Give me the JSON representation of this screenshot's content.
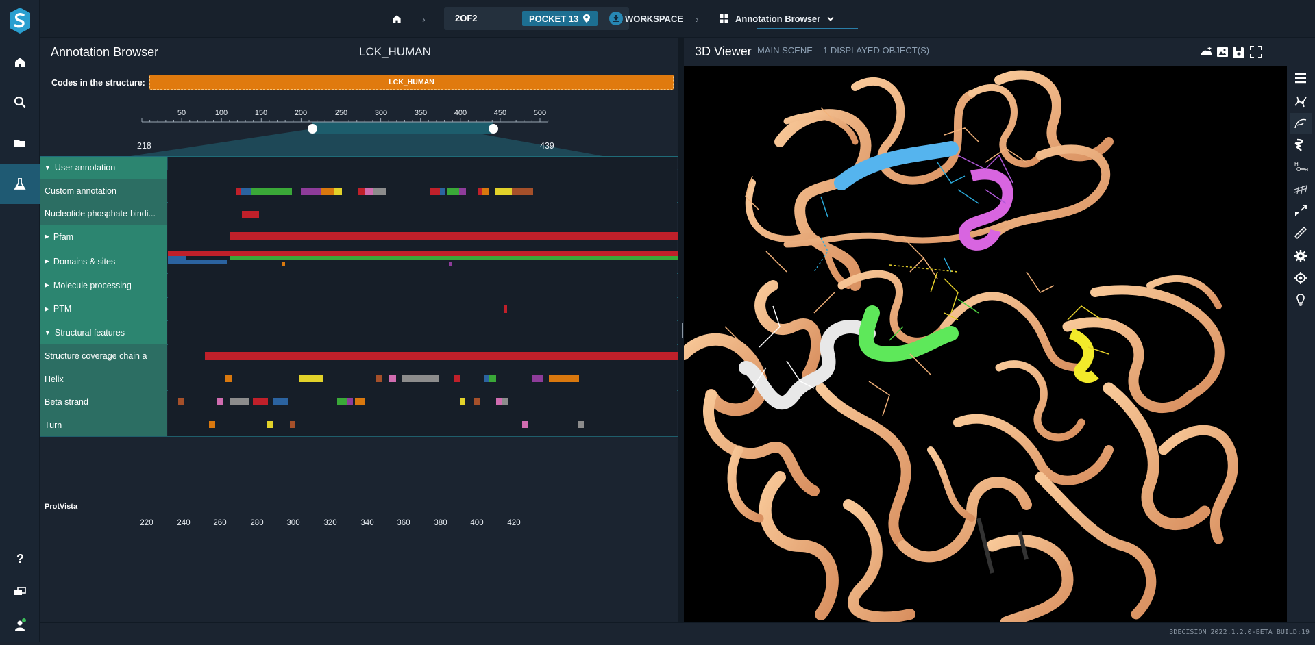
{
  "colors": {
    "accent": "#1d6f92",
    "track_label": "#2c6e63",
    "track_group": "#2c8570",
    "codes_bar": "#e07a0e",
    "protein_ribbon": "#f8c090"
  },
  "nav": {
    "logo_icon": "3decision-logo",
    "items": [
      {
        "name": "home-icon"
      },
      {
        "name": "search-icon"
      },
      {
        "name": "folder-icon"
      },
      {
        "name": "flask-icon"
      },
      {
        "name": "help-icon"
      },
      {
        "name": "chat-icon"
      },
      {
        "name": "user-icon"
      }
    ]
  },
  "topbar": {
    "structure": "2OF2",
    "pocket": "POCKET 13",
    "workspace": "WORKSPACE",
    "view": "Annotation Browser"
  },
  "annotation": {
    "title": "Annotation Browser",
    "protein": "LCK_HUMAN",
    "codes_label": "Codes in the structure:",
    "code": "LCK_HUMAN",
    "protvista": "ProtVista",
    "range_start": "218",
    "range_end": "439",
    "overview_ticks": [
      "50",
      "100",
      "150",
      "200",
      "250",
      "300",
      "350",
      "400",
      "450",
      "500"
    ],
    "detail_ticks": [
      "220",
      "240",
      "260",
      "280",
      "300",
      "320",
      "340",
      "360",
      "380",
      "400",
      "420"
    ],
    "tracks": [
      {
        "label": "User annotation",
        "group": true,
        "expand": "▼"
      },
      {
        "label": "Custom annotation",
        "group": false,
        "expand": ""
      },
      {
        "label": "Nucleotide phosphate-bindi...",
        "group": false,
        "expand": ""
      },
      {
        "label": "Pfam",
        "group": true,
        "expand": "▶"
      },
      {
        "label": "Domains & sites",
        "group": true,
        "expand": "▶"
      },
      {
        "label": "Molecule processing",
        "group": true,
        "expand": "▶"
      },
      {
        "label": "PTM",
        "group": true,
        "expand": "▶"
      },
      {
        "label": "Structural features",
        "group": true,
        "expand": "▼"
      },
      {
        "label": "Structure coverage chain a",
        "group": false,
        "expand": ""
      },
      {
        "label": "Helix",
        "group": false,
        "expand": ""
      },
      {
        "label": "Beta strand",
        "group": false,
        "expand": ""
      },
      {
        "label": "Turn",
        "group": false,
        "expand": ""
      }
    ]
  },
  "viewer": {
    "title": "3D Viewer",
    "scene": "MAIN SCENE",
    "count": "1 DISPLAYED OBJECT(S)",
    "head_icons": [
      "surface-icon",
      "image-icon",
      "save-icon",
      "fullscreen-icon"
    ],
    "tools": [
      "menu-icon",
      "molecule-icon",
      "ligand-icon",
      "ribbon-icon",
      "hydrogen-icon",
      "surface-mesh-icon",
      "distance-icon",
      "ruler-icon",
      "settings-icon",
      "target-icon",
      "bulb-icon"
    ]
  },
  "status": {
    "build": "3DECISION 2022.1.2.0-BETA BUILD:19"
  }
}
